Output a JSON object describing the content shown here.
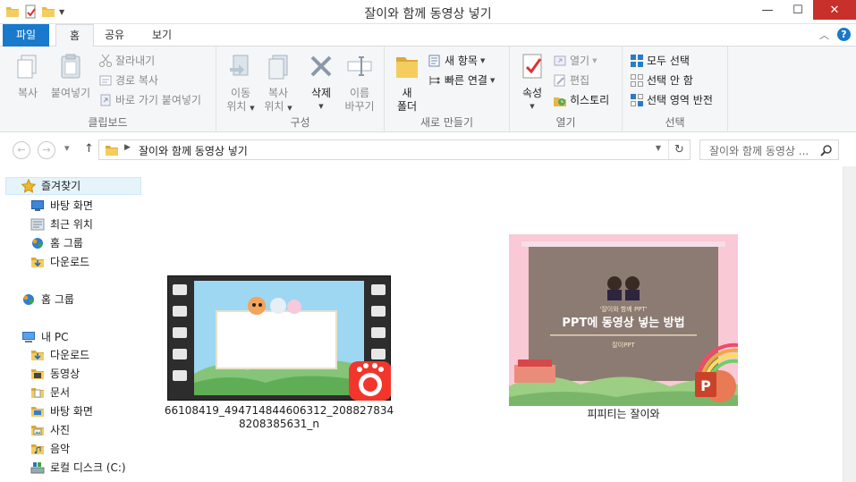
{
  "window": {
    "title": "잘이와 함께 동영상 넣기"
  },
  "tabs": {
    "file": "파일",
    "home": "홈",
    "share": "공유",
    "view": "보기"
  },
  "ribbon": {
    "clipboard": {
      "label": "클립보드",
      "copy": "복사",
      "paste": "붙여넣기",
      "cut": "잘라내기",
      "copy_path": "경로 복사",
      "paste_shortcut": "바로 가기 붙여넣기"
    },
    "organize": {
      "label": "구성",
      "move_to": [
        "이동",
        "위치"
      ],
      "copy_to": [
        "복사",
        "위치"
      ],
      "delete": "삭제",
      "rename": [
        "이름",
        "바꾸기"
      ]
    },
    "new": {
      "label": "새로 만들기",
      "new_folder": [
        "새",
        "폴더"
      ],
      "new_item": "새 항목",
      "easy_access": "빠른 연결"
    },
    "open": {
      "label": "열기",
      "properties": "속성",
      "open": "열기",
      "edit": "편집",
      "history": "히스토리"
    },
    "select": {
      "label": "선택",
      "select_all": "모두 선택",
      "select_none": "선택 안 함",
      "invert": "선택 영역 반전"
    }
  },
  "address": {
    "path": "잘이와 함께 동영상 넣기",
    "search_placeholder": "잘이와 함께 동영상 ..."
  },
  "nav": {
    "favorites": "즐겨찾기",
    "desktop": "바탕 화면",
    "recent": "최근 위치",
    "homegroup_fav": "홈 그룹",
    "downloads_fav": "다운로드",
    "homegroup": "홈 그룹",
    "this_pc": "내 PC",
    "pc_downloads": "다운로드",
    "videos": "동영상",
    "documents": "문서",
    "pc_desktop": "바탕 화면",
    "pictures": "사진",
    "music": "음악",
    "local_disk": "로컬 디스크 (C:)"
  },
  "files": [
    {
      "name": "66108419_494714844606312_2088278348208385631_n"
    },
    {
      "name": "피피티는 잘이와",
      "thumb_tag": "'잘이와 함께 PPT'",
      "thumb_title": "PPT에 동영상 넣는 방법",
      "thumb_sub": "잘이PPT"
    }
  ],
  "colors": {
    "accent": "#1979ca",
    "close": "#c7302b",
    "ribbon_bg": "#f5f6f7"
  }
}
